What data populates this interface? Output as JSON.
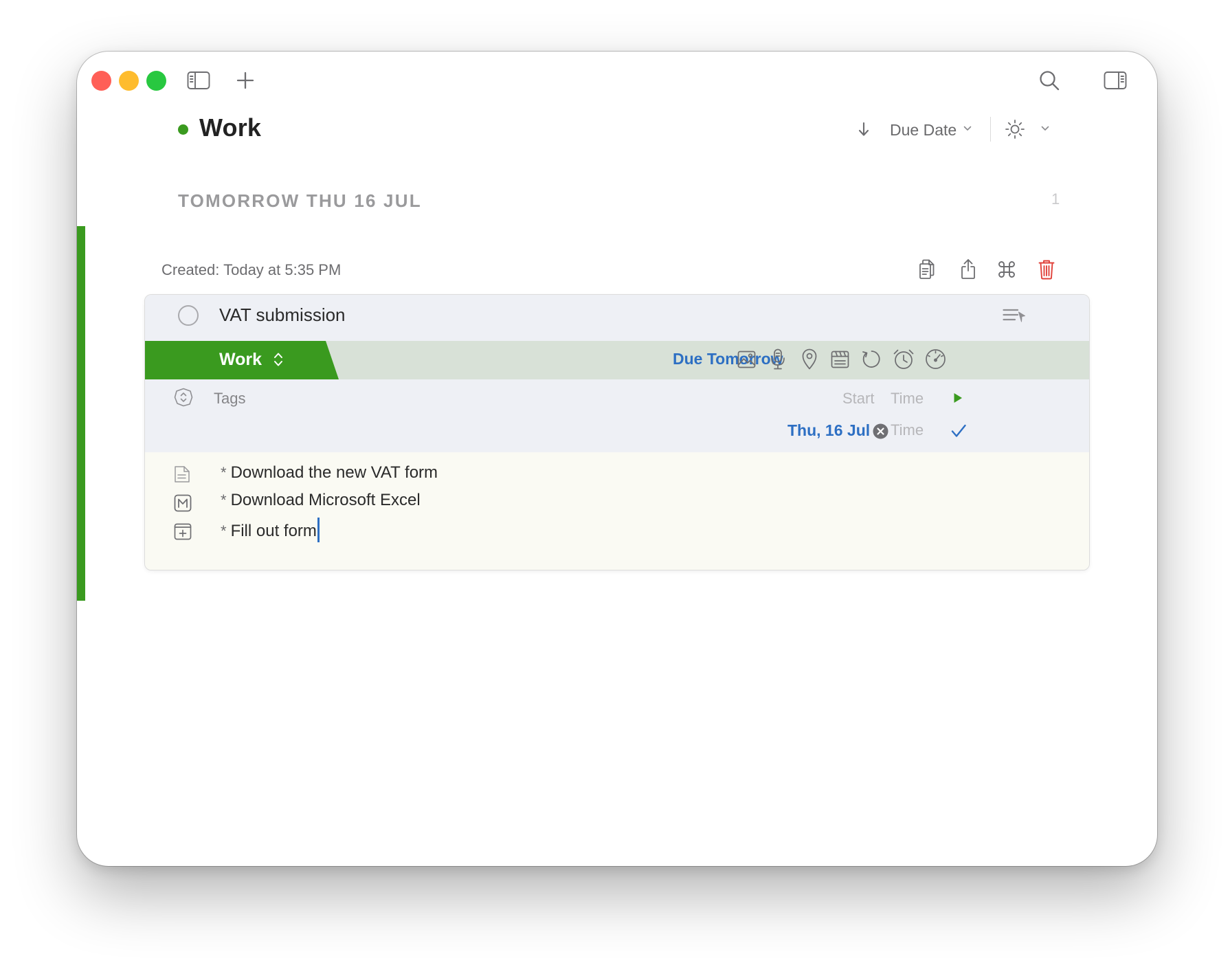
{
  "window": {
    "traffic_lights": [
      "#ff5f57",
      "#febc2e",
      "#28c840"
    ],
    "toolbar_icons": [
      "sidebar-toggle-icon",
      "plus-icon",
      "search-icon",
      "inspector-toggle-icon"
    ]
  },
  "header": {
    "title": "Work",
    "title_dot_color": "#3a9a1f",
    "sort_label": "Due Date",
    "sort_direction_icon": "arrow-down-icon",
    "view_icon": "sun-icon"
  },
  "section": {
    "label": "TOMORROW THU 16 JUL",
    "count": "1"
  },
  "task": {
    "created": "Created: Today at 5:35 PM",
    "action_icons": [
      "copy-icon",
      "share-icon",
      "command-icon",
      "trash-icon"
    ],
    "title": "VAT submission",
    "list_name": "Work",
    "list_color": "#3a9a1f",
    "due_label": "Due Tomorrow",
    "attribute_icons": [
      "image-icon",
      "microphone-icon",
      "location-icon",
      "calendar-icon",
      "repeat-icon",
      "alarm-icon",
      "gauge-icon"
    ],
    "tags_placeholder": "Tags",
    "start_label": "Start",
    "start_time_label": "Time",
    "deadline_date": "Thu, 16 Jul",
    "deadline_time_label": "Time",
    "notes": [
      "Download the new VAT form",
      "Download Microsoft Excel",
      "Fill out form"
    ],
    "note_icons": [
      "note-icon",
      "markdown-icon",
      "add-checklist-icon"
    ]
  }
}
